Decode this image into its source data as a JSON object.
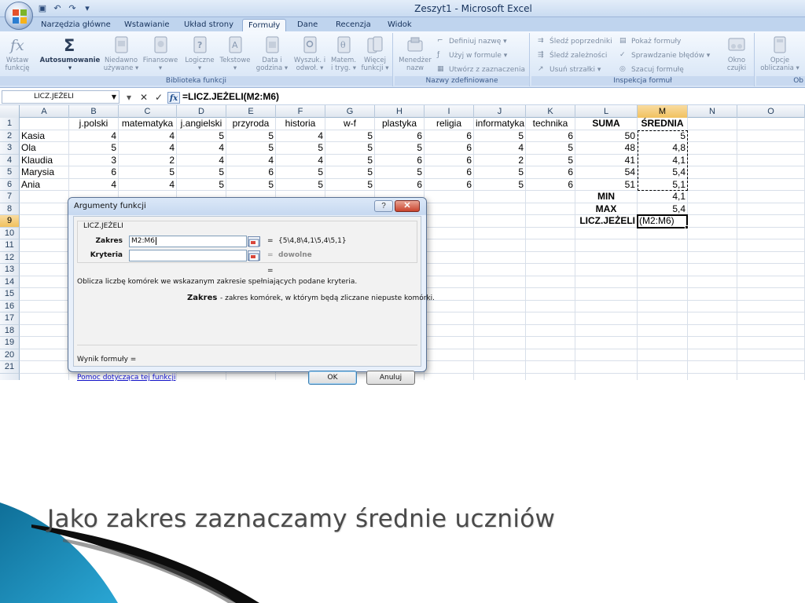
{
  "window": {
    "title": "Zeszyt1 - Microsoft Excel"
  },
  "ribbon": {
    "tabs": [
      "Narzędzia główne",
      "Wstawianie",
      "Układ strony",
      "Formuły",
      "Dane",
      "Recenzja",
      "Widok"
    ],
    "active_tab": "Formuły",
    "insert_function": {
      "line1": "Wstaw",
      "line2": "funkcję"
    },
    "library": {
      "autosum": "Autosumowanie",
      "recent": {
        "line1": "Niedawno",
        "line2": "używane ▾"
      },
      "financial": "Finansowe ▾",
      "logical": "Logiczne ▾",
      "text": "Tekstowe ▾",
      "datetime": {
        "line1": "Data i",
        "line2": "godzina ▾"
      },
      "lookup": {
        "line1": "Wyszuk. i",
        "line2": "odwoł. ▾"
      },
      "math": {
        "line1": "Matem.",
        "line2": "i tryg. ▾"
      },
      "more": {
        "line1": "Więcej",
        "line2": "funkcji ▾"
      },
      "group_label": "Biblioteka funkcji"
    },
    "names": {
      "manager": {
        "line1": "Menedżer",
        "line2": "nazw"
      },
      "define": "Definiuj nazwę ▾",
      "use_in_formula": "Użyj w formule ▾",
      "create_from_selection": "Utwórz z zaznaczenia",
      "group_label": "Nazwy zdefiniowane"
    },
    "audit": {
      "trace_precedents": "Śledź poprzedniki",
      "trace_dependents": "Śledź zależności",
      "remove_arrows": "Usuń strzałki ▾",
      "show_formulas": "Pokaż formuły",
      "error_checking": "Sprawdzanie błędów ▾",
      "evaluate": "Szacuj formułę",
      "watch": {
        "line1": "Okno",
        "line2": "czujki"
      },
      "group_label": "Inspekcja formuł"
    },
    "calc": {
      "options": {
        "line1": "Opcje",
        "line2": "obliczania ▾"
      },
      "group_label": "Ob"
    }
  },
  "formula_bar": {
    "name_box": "LICZ.JEŻELI",
    "formula": "=LICZ.JEŻELI(M2:M6)"
  },
  "sheet": {
    "columns": [
      "A",
      "B",
      "C",
      "D",
      "E",
      "F",
      "G",
      "H",
      "I",
      "J",
      "K",
      "L",
      "M",
      "N",
      "O"
    ],
    "selected_column": "M",
    "row_numbers": [
      "1",
      "2",
      "3",
      "4",
      "5",
      "6",
      "7",
      "8",
      "9",
      "10",
      "11",
      "12",
      "13",
      "14",
      "15",
      "16",
      "17",
      "18",
      "19",
      "20",
      "21"
    ],
    "selected_row": "9",
    "header_row": [
      "",
      "j.polski",
      "matematyka",
      "j.angielski",
      "przyroda",
      "historia",
      "w-f",
      "plastyka",
      "religia",
      "informatyka",
      "technika",
      "SUMA",
      "ŚREDNIA"
    ],
    "students": [
      {
        "name": "Kasia",
        "grades": [
          "4",
          "4",
          "5",
          "5",
          "4",
          "5",
          "6",
          "6",
          "5",
          "6"
        ],
        "sum": "50",
        "avg": "5"
      },
      {
        "name": "Ola",
        "grades": [
          "5",
          "4",
          "4",
          "5",
          "5",
          "5",
          "5",
          "6",
          "4",
          "5"
        ],
        "sum": "48",
        "avg": "4,8"
      },
      {
        "name": "Klaudia",
        "grades": [
          "3",
          "2",
          "4",
          "4",
          "4",
          "5",
          "6",
          "6",
          "2",
          "5"
        ],
        "sum": "41",
        "avg": "4,1"
      },
      {
        "name": "Marysia",
        "grades": [
          "6",
          "5",
          "5",
          "6",
          "5",
          "5",
          "5",
          "6",
          "5",
          "6"
        ],
        "sum": "54",
        "avg": "5,4"
      },
      {
        "name": "Ania",
        "grades": [
          "4",
          "4",
          "5",
          "5",
          "5",
          "5",
          "6",
          "6",
          "5",
          "6"
        ],
        "sum": "51",
        "avg": "5,1"
      }
    ],
    "summary": [
      {
        "label": "MIN",
        "value": "4,1"
      },
      {
        "label": "MAX",
        "value": "5,4"
      },
      {
        "label": "LICZ.JEŻELI",
        "value": "(M2:M6)"
      }
    ]
  },
  "dialog": {
    "title": "Argumenty funkcji",
    "help_glyph": "?",
    "close_glyph": "✕",
    "function_name": "LICZ.JEŻELI",
    "range_label": "Zakres",
    "range_value": "M2:M6",
    "range_result": "{5\\4,8\\4,1\\5,4\\5,1}",
    "criteria_label": "Kryteria",
    "criteria_value": "",
    "criteria_result": "dowolne",
    "equals": "=",
    "overall_result": "=",
    "description": "Oblicza liczbę komórek we wskazanym zakresie spełniających podane kryteria.",
    "arg_help_label": "Zakres",
    "arg_help_text": "- zakres komórek, w którym będą zliczane niepuste komórki.",
    "result_label": "Wynik formuły =",
    "help_link": "Pomoc dotycząca tej funkcji",
    "ok": "OK",
    "cancel": "Anuluj"
  },
  "slide": {
    "caption": "Jako zakres zaznaczamy średnie uczniów"
  },
  "colors": {
    "ribbon_bg": "#dbe7f6",
    "selection_header": "#f1c15f",
    "swoosh_blue": "#1f8db8",
    "caption": "#4a4a4a"
  }
}
